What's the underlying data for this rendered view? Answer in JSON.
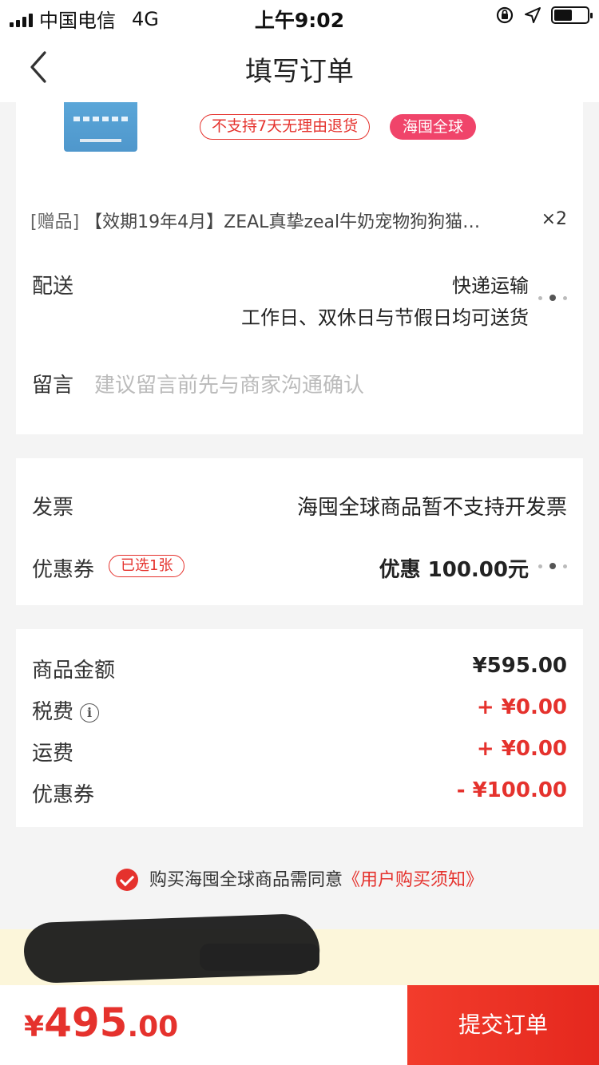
{
  "status_bar": {
    "carrier": "中国电信",
    "network": "4G",
    "time": "上午9:02"
  },
  "nav": {
    "title": "填写订单"
  },
  "product": {
    "tag_no_return": "不支持7天无理由退货",
    "tag_global": "海囤全球"
  },
  "gift": {
    "label": "[赠品]",
    "title": "【效期19年4月】ZEAL真挚zeal牛奶宠物狗狗猫…",
    "qty": "×2"
  },
  "delivery": {
    "label": "配送",
    "method": "快递运输",
    "schedule": "工作日、双休日与节假日均可送货"
  },
  "message": {
    "label": "留言",
    "placeholder": "建议留言前先与商家沟通确认"
  },
  "invoice": {
    "label": "发票",
    "value": "海囤全球商品暂不支持开发票"
  },
  "coupon": {
    "label": "优惠券",
    "badge": "已选1张",
    "value": "优惠 100.00元"
  },
  "amounts": {
    "goods_label": "商品金额",
    "goods_value": "¥595.00",
    "tax_label": "税费",
    "tax_value": "+ ¥0.00",
    "shipping_label": "运费",
    "shipping_value": "+ ¥0.00",
    "coupon_label": "优惠券",
    "coupon_value": "- ¥100.00"
  },
  "agreement": {
    "text": "购买海囤全球商品需同意",
    "link": "《用户购买须知》"
  },
  "footer": {
    "currency": "¥",
    "total_int": "495",
    "total_dec": ".00",
    "submit": "提交订单"
  },
  "colors": {
    "accent": "#e5322d",
    "pink_tag": "#f0446a",
    "notice_bg": "#fcf6da"
  }
}
